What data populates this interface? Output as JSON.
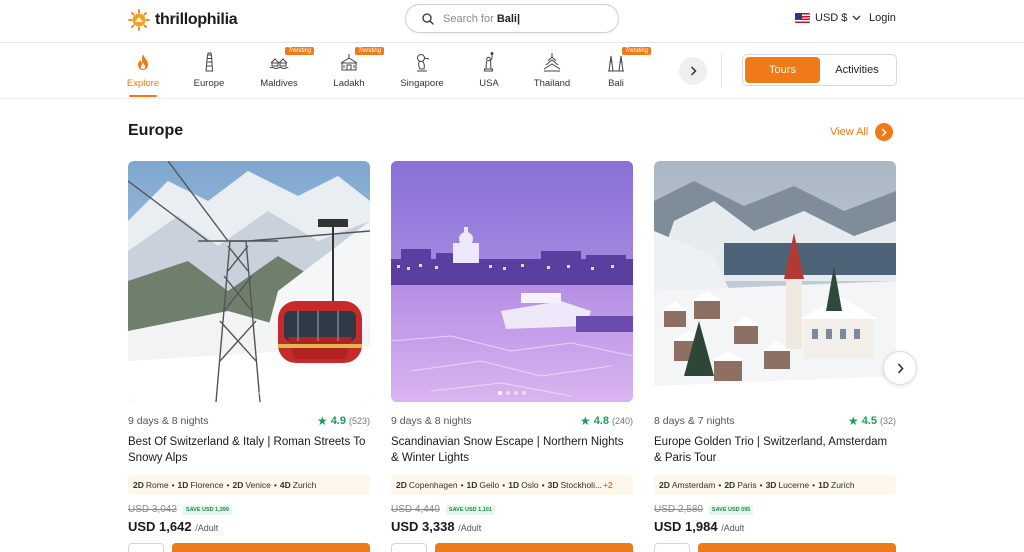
{
  "header": {
    "logo_text": "thrillophilia",
    "search_placeholder": "Search for",
    "search_term": "Bali|",
    "currency": "USD $",
    "login": "Login"
  },
  "categories": [
    {
      "label": "Explore",
      "active": true,
      "badge": ""
    },
    {
      "label": "Europe",
      "active": false,
      "badge": ""
    },
    {
      "label": "Maldives",
      "active": false,
      "badge": "Trending"
    },
    {
      "label": "Ladakh",
      "active": false,
      "badge": "Trending"
    },
    {
      "label": "Singapore",
      "active": false,
      "badge": ""
    },
    {
      "label": "USA",
      "active": false,
      "badge": ""
    },
    {
      "label": "Thailand",
      "active": false,
      "badge": ""
    },
    {
      "label": "Bali",
      "active": false,
      "badge": "Trending"
    }
  ],
  "toggle": {
    "tours": "Tours",
    "activities": "Activities"
  },
  "section": {
    "title": "Europe",
    "view_all": "View All"
  },
  "cards": [
    {
      "duration": "9 days & 8 nights",
      "rating": "4.9",
      "reviews": "(523)",
      "title": "Best Of Switzerland & Italy | Roman Streets To Snowy Alps",
      "itinerary": [
        [
          "2D",
          "Rome"
        ],
        [
          "1D",
          "Florence"
        ],
        [
          "2D",
          "Venice"
        ],
        [
          "4D",
          "Zurich"
        ]
      ],
      "more": "",
      "old_price": "USD 3,042",
      "save": "SAVE USD 1,399",
      "price": "USD 1,642",
      "per": "/Adult"
    },
    {
      "duration": "9 days & 8 nights",
      "rating": "4.8",
      "reviews": "(240)",
      "title": "Scandinavian Snow Escape | Northern Nights & Winter Lights",
      "itinerary": [
        [
          "2D",
          "Copenhagen"
        ],
        [
          "1D",
          "Geilo"
        ],
        [
          "1D",
          "Oslo"
        ],
        [
          "3D",
          "Stockholi..."
        ]
      ],
      "more": "+2",
      "old_price": "USD 4,440",
      "save": "SAVE USD 1,101",
      "price": "USD 3,338",
      "per": "/Adult"
    },
    {
      "duration": "8 days & 7 nights",
      "rating": "4.5",
      "reviews": "(32)",
      "title": "Europe Golden Trio | Switzerland, Amsterdam & Paris Tour",
      "itinerary": [
        [
          "2D",
          "Amsterdam"
        ],
        [
          "2D",
          "Paris"
        ],
        [
          "3D",
          "Lucerne"
        ],
        [
          "1D",
          "Zurich"
        ]
      ],
      "more": "",
      "old_price": "USD 2,580",
      "save": "SAVE USD 595",
      "price": "USD 1,984",
      "per": "/Adult"
    }
  ],
  "colors": {
    "accent": "#f07a17",
    "rating": "#1f9d55"
  }
}
